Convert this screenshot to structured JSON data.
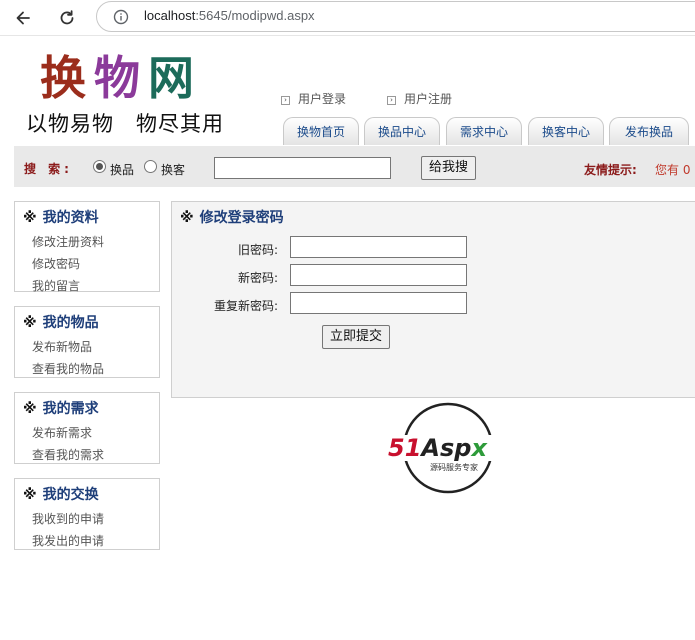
{
  "browser": {
    "url_host": "localhost",
    "url_rest": ":5645/modipwd.aspx"
  },
  "header": {
    "logo": [
      "换",
      "物",
      "网"
    ],
    "slogan": "以物易物　物尽其用",
    "links": [
      "用户登录",
      "用户注册"
    ],
    "tabs": [
      "换物首页",
      "换品中心",
      "需求中心",
      "换客中心",
      "发布换品"
    ]
  },
  "search": {
    "label": "搜 索:",
    "options": [
      "换品",
      "换客"
    ],
    "selected": "换品",
    "query": "",
    "button": "给我搜",
    "tip_label": "友情提示:",
    "tip_text": "您有 0"
  },
  "sidebar": [
    {
      "title": "我的资料",
      "items": [
        "修改注册资料",
        "修改密码",
        "我的留言"
      ]
    },
    {
      "title": "我的物品",
      "items": [
        "发布新物品",
        "查看我的物品"
      ]
    },
    {
      "title": "我的需求",
      "items": [
        "发布新需求",
        "查看我的需求"
      ]
    },
    {
      "title": "我的交换",
      "items": [
        "我收到的申请",
        "我发出的申请"
      ]
    }
  ],
  "main": {
    "title": "修改登录密码",
    "fields": [
      {
        "label": "旧密码:",
        "value": ""
      },
      {
        "label": "新密码:",
        "value": ""
      },
      {
        "label": "重复新密码:",
        "value": ""
      }
    ],
    "submit": "立即提交"
  },
  "badge": {
    "brand": "51Aspx",
    "tagline": "源码服务专家"
  },
  "mark": "※",
  "colors": {
    "title_blue": "#1f3f7a",
    "label_red": "#8b1a1a",
    "panel_bg": "#f4f4f4",
    "bar_bg": "#e9e9e9"
  }
}
